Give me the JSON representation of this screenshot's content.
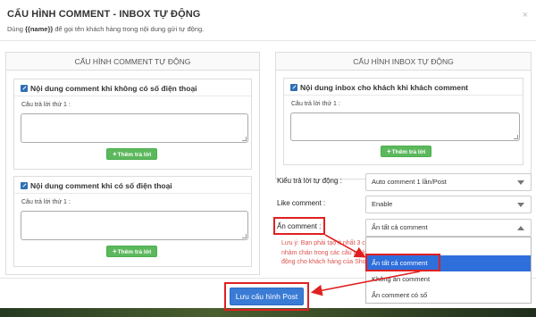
{
  "modal": {
    "title": "CẤU HÌNH COMMENT - INBOX TỰ ĐỘNG",
    "subtitle_prefix": "Dùng ",
    "subtitle_token": "{{name}}",
    "subtitle_suffix": " để gọi tên khách hàng trong nội dung gửi tự động.",
    "close": "×"
  },
  "left": {
    "header": "CẤU HÌNH COMMENT TỰ ĐỘNG",
    "panel1": {
      "title": "Nội dung comment khi không có số điện thoại",
      "answer_label": "Câu trả lời thứ 1 :",
      "add_button": "Thêm trả lời"
    },
    "panel2": {
      "title": "Nội dung comment khi có số điện thoại",
      "answer_label": "Câu trả lời thứ 1 :",
      "add_button": "Thêm trả lời"
    }
  },
  "right": {
    "header": "CẤU HÌNH INBOX TỰ ĐỘNG",
    "panel": {
      "title": "Nội dung inbox cho khách khi khách comment",
      "answer_label": "Câu trả lời thứ 1 :",
      "add_button": "Thêm trả lời"
    },
    "reply_type": {
      "label": "Kiểu trả lời tự động :",
      "value": "Auto comment 1 lần/Post"
    },
    "like_comment": {
      "label": "Like comment :",
      "value": "Enable"
    },
    "hide_comment": {
      "label": "Ẩn comment :",
      "value": "Ẩn tất cả comment",
      "options": [
        "Ẩn tất cả comment",
        "Không ẩn comment",
        "Ẩn comment có số"
      ]
    },
    "warning": "Lưu ý: Bạn phải tạo ít nhất 3 c nhàm chán trong các câu trả lời động cho khách hàng của Sho"
  },
  "footer": {
    "save_button": "Lưu cấu hình Post"
  },
  "colors": {
    "primary": "#3a7bd5",
    "success": "#5cb85c",
    "danger": "#d9534f",
    "highlight": "#e02020",
    "selected": "#2f6fdc"
  },
  "icons": {
    "panel": "pencil-square-icon",
    "add": "plus-icon",
    "close": "close-icon",
    "select": "caret-down-icon"
  }
}
